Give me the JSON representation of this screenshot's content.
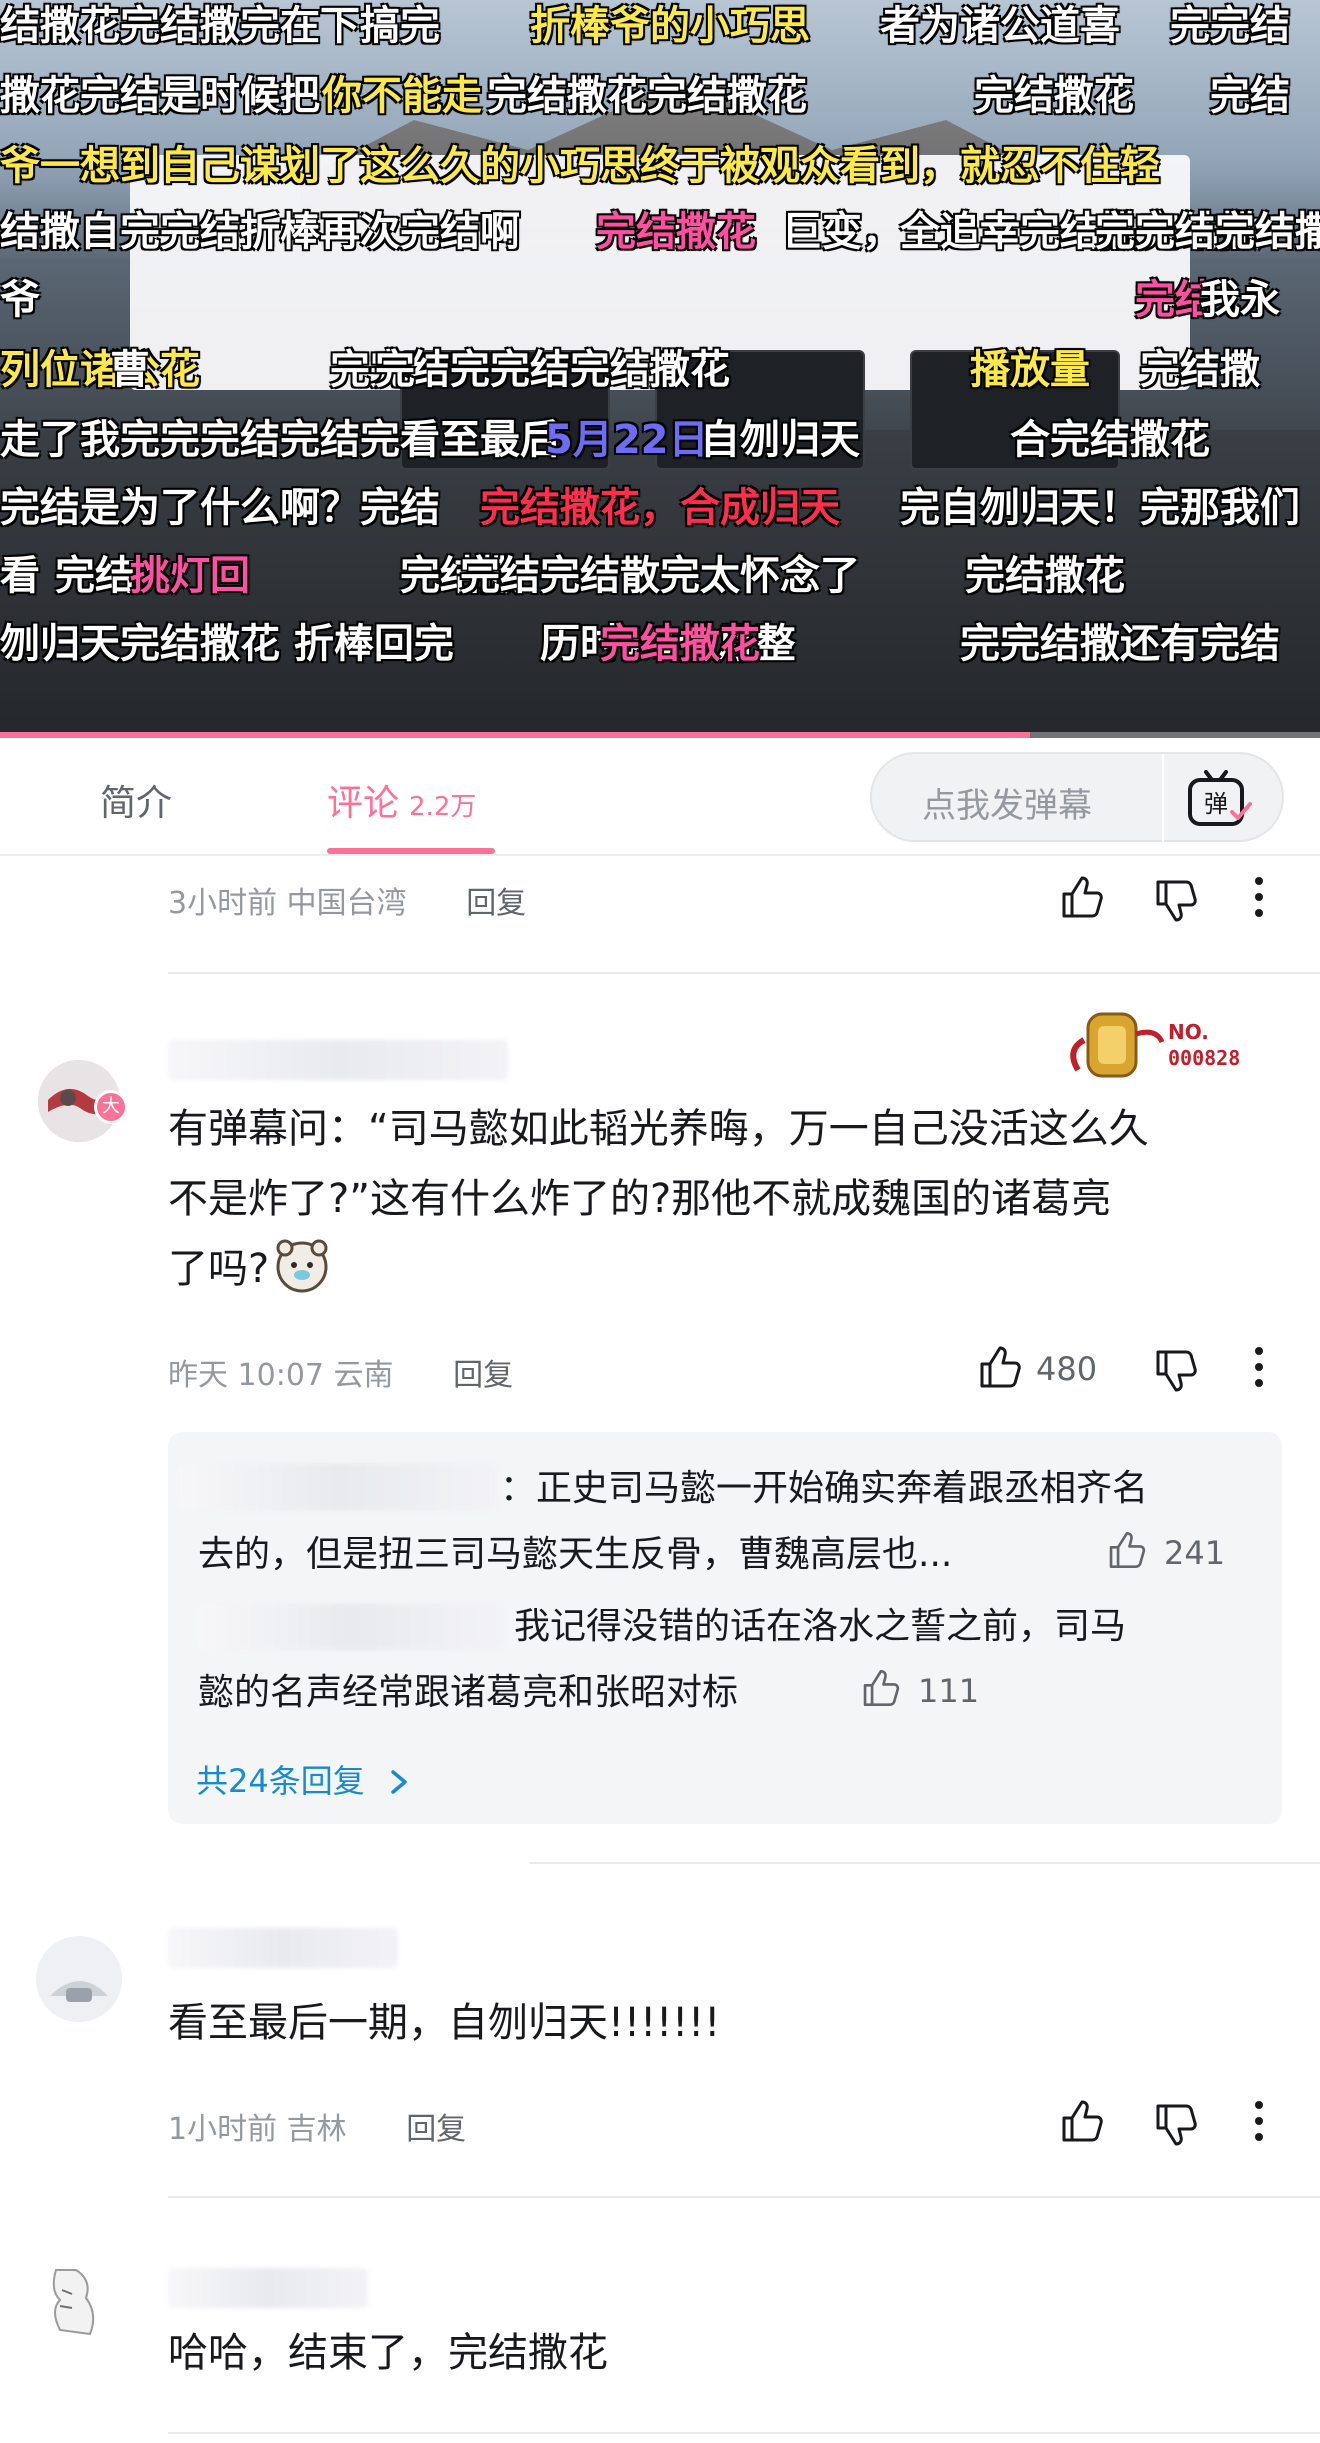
{
  "video": {
    "progress_fraction": 0.78,
    "danmaku": [
      {
        "text": "结撒花完结撒完在下搞完",
        "color": "white"
      },
      {
        "text": "折棒爷的小巧思",
        "color": "yellow"
      },
      {
        "text": "者为诸公道喜",
        "color": "white"
      },
      {
        "text": "完完结",
        "color": "white"
      },
      {
        "text": "撒花完结是时候把",
        "color": "white"
      },
      {
        "text": "你不能走",
        "color": "yellow"
      },
      {
        "text": "完结撒花完结撒花",
        "color": "white"
      },
      {
        "text": "完结撒花",
        "color": "white"
      },
      {
        "text": "完结",
        "color": "white"
      },
      {
        "text": "爷一想到自己谋划了这么久的小巧思终于被观众看到，就忍不住轻",
        "color": "yellow"
      },
      {
        "text": "结撒自完完结折棒再次完结啊",
        "color": "white"
      },
      {
        "text": "完结撒花",
        "color": "pink"
      },
      {
        "text": "巨变，",
        "color": "white"
      },
      {
        "text": "全追幸完结撒完结撒",
        "color": "white"
      },
      {
        "text": "完完结完结撒完完开始完结撒完结撒花生日",
        "color": "white"
      },
      {
        "text": "爷",
        "color": "white"
      },
      {
        "text": "完结",
        "color": "pink"
      },
      {
        "text": "我永",
        "color": "white"
      },
      {
        "text": "列位诸公花",
        "color": "yellow"
      },
      {
        "text": "曹",
        "color": "white"
      },
      {
        "text": "完完结完完结完结撒花",
        "color": "white"
      },
      {
        "text": "完",
        "color": "white"
      },
      {
        "text": "播放量",
        "color": "yellow"
      },
      {
        "text": "完结撒",
        "color": "white"
      },
      {
        "text": "走了我完完完结完结完看至最后",
        "color": "white"
      },
      {
        "text": "5月22日",
        "color": "blue"
      },
      {
        "text": "自刎归天",
        "color": "white"
      },
      {
        "text": "合完结撒花",
        "color": "white"
      },
      {
        "text": "完结是为了什么啊？完结",
        "color": "white"
      },
      {
        "text": "完结撒花，合成归天",
        "color": "red"
      },
      {
        "text": "完自刎归天！完那我们",
        "color": "white"
      },
      {
        "text": "看",
        "color": "white"
      },
      {
        "text": "完结",
        "color": "white"
      },
      {
        "text": "挑灯回",
        "color": "pink"
      },
      {
        "text": "完结撒",
        "color": "white"
      },
      {
        "text": "完结完结散完太怀念了",
        "color": "white"
      },
      {
        "text": "完结撒花",
        "color": "white"
      },
      {
        "text": "刎归天完结撒花 折棒回完",
        "color": "white"
      },
      {
        "text": "历时19个月整",
        "color": "white"
      },
      {
        "text": "完结撒花",
        "color": "pink"
      },
      {
        "text": "完完结撒还有完结",
        "color": "white"
      }
    ]
  },
  "tabs": {
    "intro": "简介",
    "comments": "评论",
    "comments_count": "2.2万",
    "danmu_placeholder": "点我发弹幕",
    "danmu_button": "弹"
  },
  "comments": [
    {
      "time": "3小时前",
      "location": "中国台湾",
      "reply_label": "回复"
    },
    {
      "badge_no": "NO.",
      "badge_num": "000828",
      "avatar_badge": "大",
      "lines": [
        "有弹幕问：“司马懿如此韬光养晦，万一自己没活这么久",
        "不是炸了?”这有什么炸了的?那他不就成魏国的诸葛亮",
        "了吗?"
      ],
      "time": "昨天 10:07",
      "location": "云南",
      "reply_label": "回复",
      "likes": "480",
      "sub_replies": [
        {
          "line1": "：正史司马懿一开始确实奔着跟丞相齐名",
          "line2": "去的，但是扭三司马懿天生反骨，曹魏高层也...",
          "likes": "241"
        },
        {
          "line1": "我记得没错的话在洛水之誓之前，司马",
          "line2": "懿的名声经常跟诸葛亮和张昭对标",
          "likes": "111"
        }
      ],
      "total_replies": "共24条回复"
    },
    {
      "text": "看至最后一期，自刎归天!!!!!!!",
      "time": "1小时前",
      "location": "吉林",
      "reply_label": "回复"
    },
    {
      "text": "哈哈，结束了，完结撒花"
    }
  ],
  "colors": {
    "accent_pink": "#fb7299",
    "link_blue": "#178bcf",
    "meta_gray": "#9499a0"
  }
}
